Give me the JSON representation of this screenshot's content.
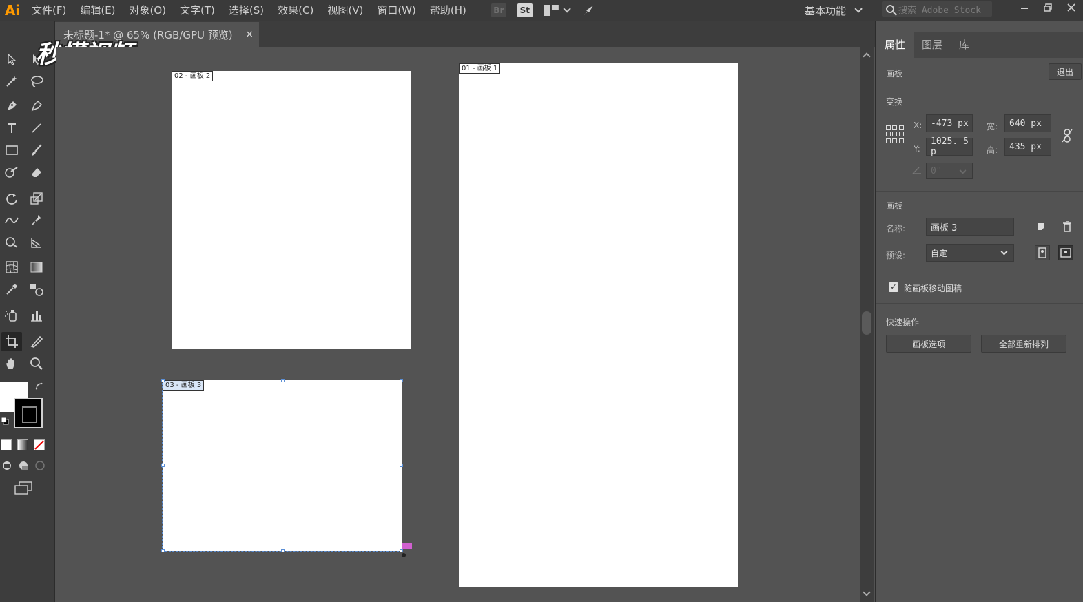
{
  "app": {
    "logo": "Ai"
  },
  "menu": [
    {
      "label": "文件(F)"
    },
    {
      "label": "编辑(E)"
    },
    {
      "label": "对象(O)"
    },
    {
      "label": "文字(T)"
    },
    {
      "label": "选择(S)"
    },
    {
      "label": "效果(C)"
    },
    {
      "label": "视图(V)"
    },
    {
      "label": "窗口(W)"
    },
    {
      "label": "帮助(H)"
    }
  ],
  "menu_icons": {
    "bridge": "Br",
    "stock": "St"
  },
  "workspace": {
    "label": "基本功能"
  },
  "stock_search": {
    "placeholder": "搜索 Adobe Stock"
  },
  "document_tab": {
    "title": "未标题-1* @ 65% (RGB/GPU 预览)",
    "close": "×"
  },
  "watermark": {
    "text": "秒懂视频"
  },
  "artboards": [
    {
      "label": "02 - 画板 2"
    },
    {
      "label": "01 - 画板 1"
    },
    {
      "label": "03 - 画板 3"
    }
  ],
  "panel": {
    "tabs": [
      {
        "label": "属性"
      },
      {
        "label": "图层"
      },
      {
        "label": "库"
      }
    ],
    "artboard_header": {
      "title": "画板",
      "exit_button": "退出"
    },
    "transform": {
      "title": "变换",
      "x_label": "X:",
      "x_value": "-473 px",
      "y_label": "Y:",
      "y_value": "1025. 5 p",
      "w_label": "宽:",
      "w_value": "640 px",
      "h_label": "高:",
      "h_value": "435 px",
      "angle_value": "0°"
    },
    "artboard_section": {
      "title": "画板",
      "name_label": "名称:",
      "name_value": "画板 3",
      "preset_label": "预设:",
      "preset_value": "自定",
      "move_with_artboard": "随画板移动图稿"
    },
    "quick_actions": {
      "title": "快速操作",
      "artboard_options": "画板选项",
      "rearrange_all": "全部重新排列"
    }
  },
  "colors": {
    "menubar": "#3a3a3a",
    "canvas": "#535353",
    "selection": "#5b8fd6",
    "ai_orange": "#ff9a00"
  }
}
